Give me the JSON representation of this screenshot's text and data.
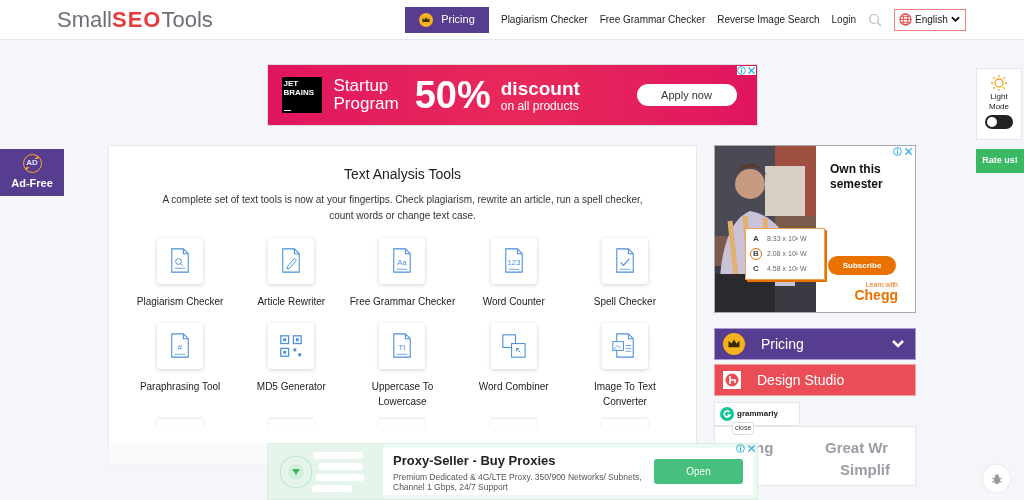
{
  "header": {
    "logo": {
      "part_1": "Small",
      "part_2": "SEO",
      "part_3": "Tools"
    },
    "pricing_button": "Pricing",
    "nav_links": [
      "Plagiarism Checker",
      "Free Grammar Checker",
      "Reverse Image Search",
      "Login"
    ],
    "language": "English"
  },
  "top_ad": {
    "brand_1": "JET",
    "brand_2": "BRAINS",
    "title_1": "Startup",
    "title_2": "Program",
    "big": "50%",
    "line_1": "discount",
    "line_2": "on all products",
    "button": "Apply now"
  },
  "ad_free": {
    "icon_text": "AD",
    "label": "Ad-Free"
  },
  "theme_toggle": {
    "label_1": "Light",
    "label_2": "Mode",
    "on": false
  },
  "rate_button": "Rate us!",
  "tools_card": {
    "title": "Text Analysis Tools",
    "description": "A complete set of text tools is now at your fingertips. Check plagiarism, rewrite an article, run a spell checker, count words or change text case.",
    "tools": [
      {
        "label": "Plagiarism Checker",
        "kind": "search-doc"
      },
      {
        "label": "Article Rewriter",
        "kind": "pen-doc"
      },
      {
        "label": "Free Grammar Checker",
        "kind": "aa-doc",
        "glyph": "Aa"
      },
      {
        "label": "Word Counter",
        "kind": "num-doc",
        "glyph": "123"
      },
      {
        "label": "Spell Checker",
        "kind": "check-doc"
      },
      {
        "label": "Paraphrasing Tool",
        "kind": "hash-doc",
        "glyph": "#"
      },
      {
        "label": "MD5 Generator",
        "kind": "qr"
      },
      {
        "label": "Uppercase To Lowercase",
        "kind": "tt-doc",
        "glyph": "Tt"
      },
      {
        "label": "Word Combiner",
        "kind": "combine"
      },
      {
        "label": "Image To Text Converter",
        "kind": "image-doc"
      }
    ]
  },
  "chegg_ad": {
    "headline": "Own this semester",
    "options": [
      {
        "letter": "A",
        "value": "8.33 x 10² W",
        "selected": false
      },
      {
        "letter": "B",
        "value": "2.08 x 10² W",
        "selected": true
      },
      {
        "letter": "C",
        "value": "4.58 x 10² W",
        "selected": false
      }
    ],
    "button": "Subscribe",
    "tagline": "Learn with",
    "brand": "Chegg"
  },
  "side_menu": [
    {
      "label": "Pricing",
      "kind": "pricing"
    },
    {
      "label": "Design Studio",
      "kind": "design"
    }
  ],
  "grammarly": {
    "brand": "grammarly",
    "tooltip": "close",
    "faded_1": "ng",
    "faded_2": "Great Wr",
    "faded_3": "Simplif"
  },
  "bottom_ad": {
    "title": "Proxy-Seller - Buy Proxies",
    "text": "Premium Dedicated & 4G/LTE Proxy. 350/900 Networks/ Subnets, Channel 1 Gbps, 24/7 Support",
    "button": "Open"
  }
}
